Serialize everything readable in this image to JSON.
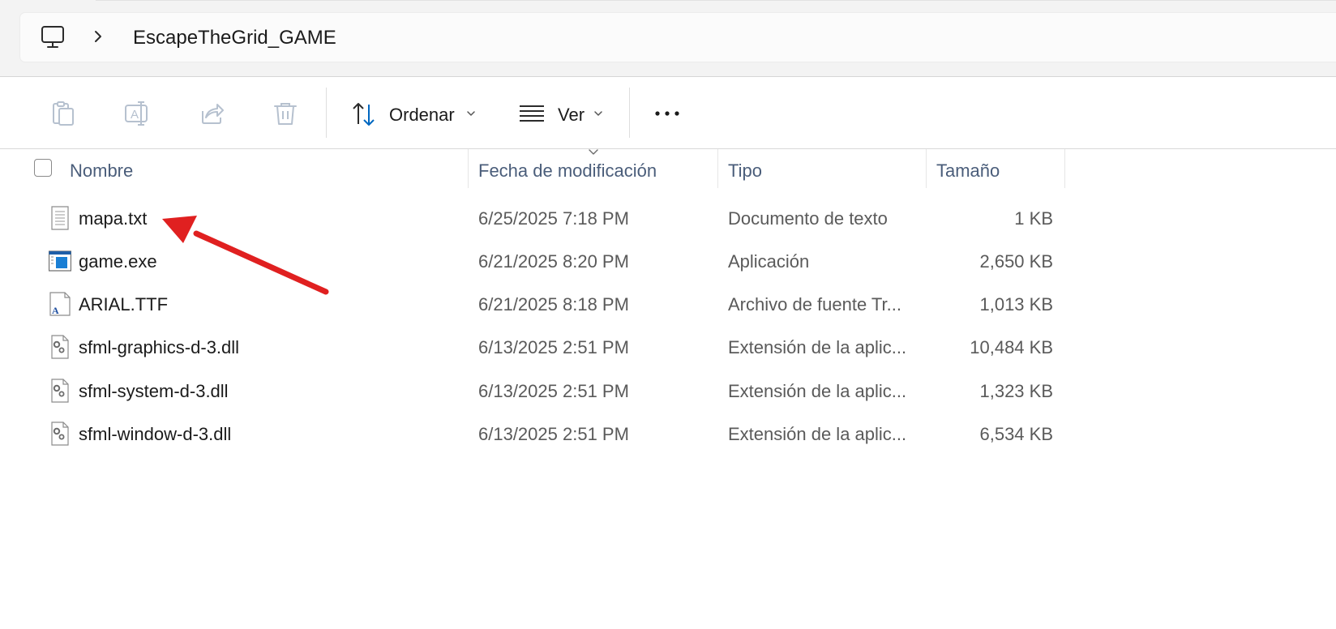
{
  "address": {
    "root_icon": "computer-icon",
    "separator_icon": "chevron-right-icon",
    "breadcrumb": "EscapeTheGrid_GAME"
  },
  "toolbar": {
    "copy_icon": "clipboard-copy-icon",
    "rename_icon": "rename-icon",
    "share_icon": "share-icon",
    "delete_icon": "trash-icon",
    "sort_icon": "sort-arrows-icon",
    "sort_label": "Ordenar",
    "view_icon": "view-lines-icon",
    "view_label": "Ver",
    "more_icon": "more-ellipsis-icon"
  },
  "columns": {
    "name": "Nombre",
    "date": "Fecha de modificación",
    "type": "Tipo",
    "size": "Tamaño"
  },
  "files": [
    {
      "name": "mapa.txt",
      "date": "6/25/2025 7:18 PM",
      "type": "Documento de texto",
      "size": "1 KB",
      "icon": "text-file-icon"
    },
    {
      "name": "game.exe",
      "date": "6/21/2025 8:20 PM",
      "type": "Aplicación",
      "size": "2,650 KB",
      "icon": "application-icon"
    },
    {
      "name": "ARIAL.TTF",
      "date": "6/21/2025 8:18 PM",
      "type": "Archivo de fuente Tr...",
      "size": "1,013 KB",
      "icon": "font-file-icon"
    },
    {
      "name": "sfml-graphics-d-3.dll",
      "date": "6/13/2025 2:51 PM",
      "type": "Extensión de la aplic...",
      "size": "10,484 KB",
      "icon": "dll-file-icon"
    },
    {
      "name": "sfml-system-d-3.dll",
      "date": "6/13/2025 2:51 PM",
      "type": "Extensión de la aplic...",
      "size": "1,323 KB",
      "icon": "dll-file-icon"
    },
    {
      "name": "sfml-window-d-3.dll",
      "date": "6/13/2025 2:51 PM",
      "type": "Extensión de la aplic...",
      "size": "6,534 KB",
      "icon": "dll-file-icon"
    }
  ],
  "annotation": {
    "icon": "red-arrow-annotation",
    "color": "#e02020"
  }
}
